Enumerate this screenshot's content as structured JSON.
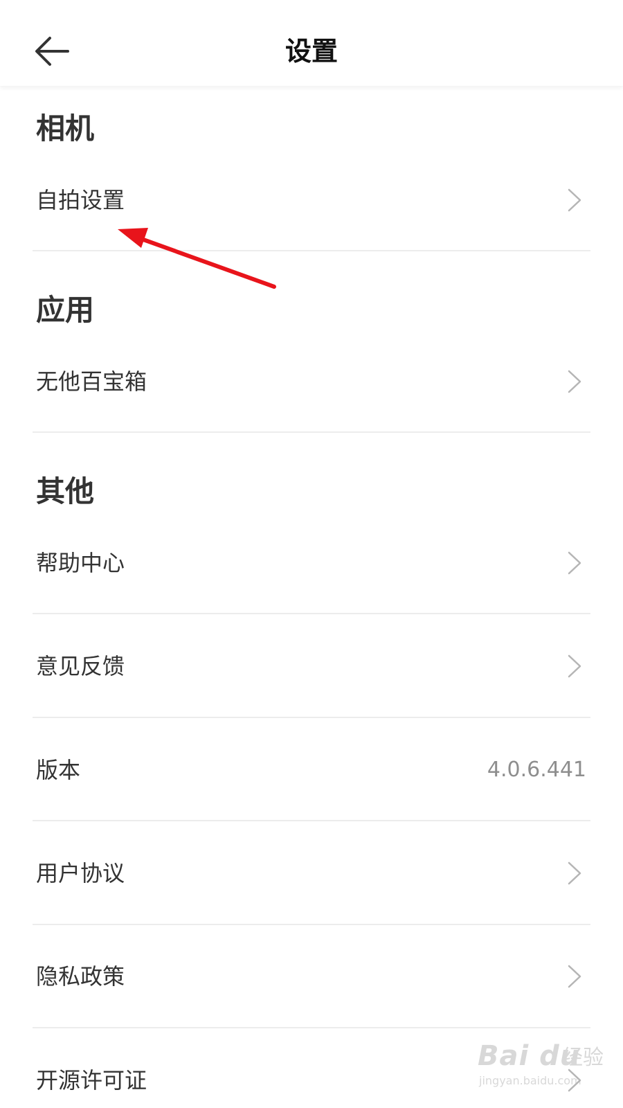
{
  "header": {
    "title": "设置",
    "back_icon": "arrow-left-icon"
  },
  "sections": {
    "camera": {
      "title": "相机",
      "items": [
        {
          "label": "自拍设置"
        }
      ]
    },
    "apps": {
      "title": "应用",
      "items": [
        {
          "label": "无他百宝箱"
        }
      ]
    },
    "other": {
      "title": "其他",
      "items": [
        {
          "label": "帮助中心"
        },
        {
          "label": "意见反馈"
        },
        {
          "label": "版本",
          "value": "4.0.6.441"
        },
        {
          "label": "用户协议"
        },
        {
          "label": "隐私政策"
        },
        {
          "label": "开源许可证"
        }
      ]
    }
  },
  "annotation": {
    "arrow_color": "#e8141b"
  },
  "watermark": {
    "logo": "Bai du",
    "text": "经验",
    "url": "jingyan.baidu.com"
  },
  "colors": {
    "text": "#333333",
    "secondary_text": "#8e8e8e",
    "divider": "#ececec",
    "chevron": "#b5b5b5"
  }
}
